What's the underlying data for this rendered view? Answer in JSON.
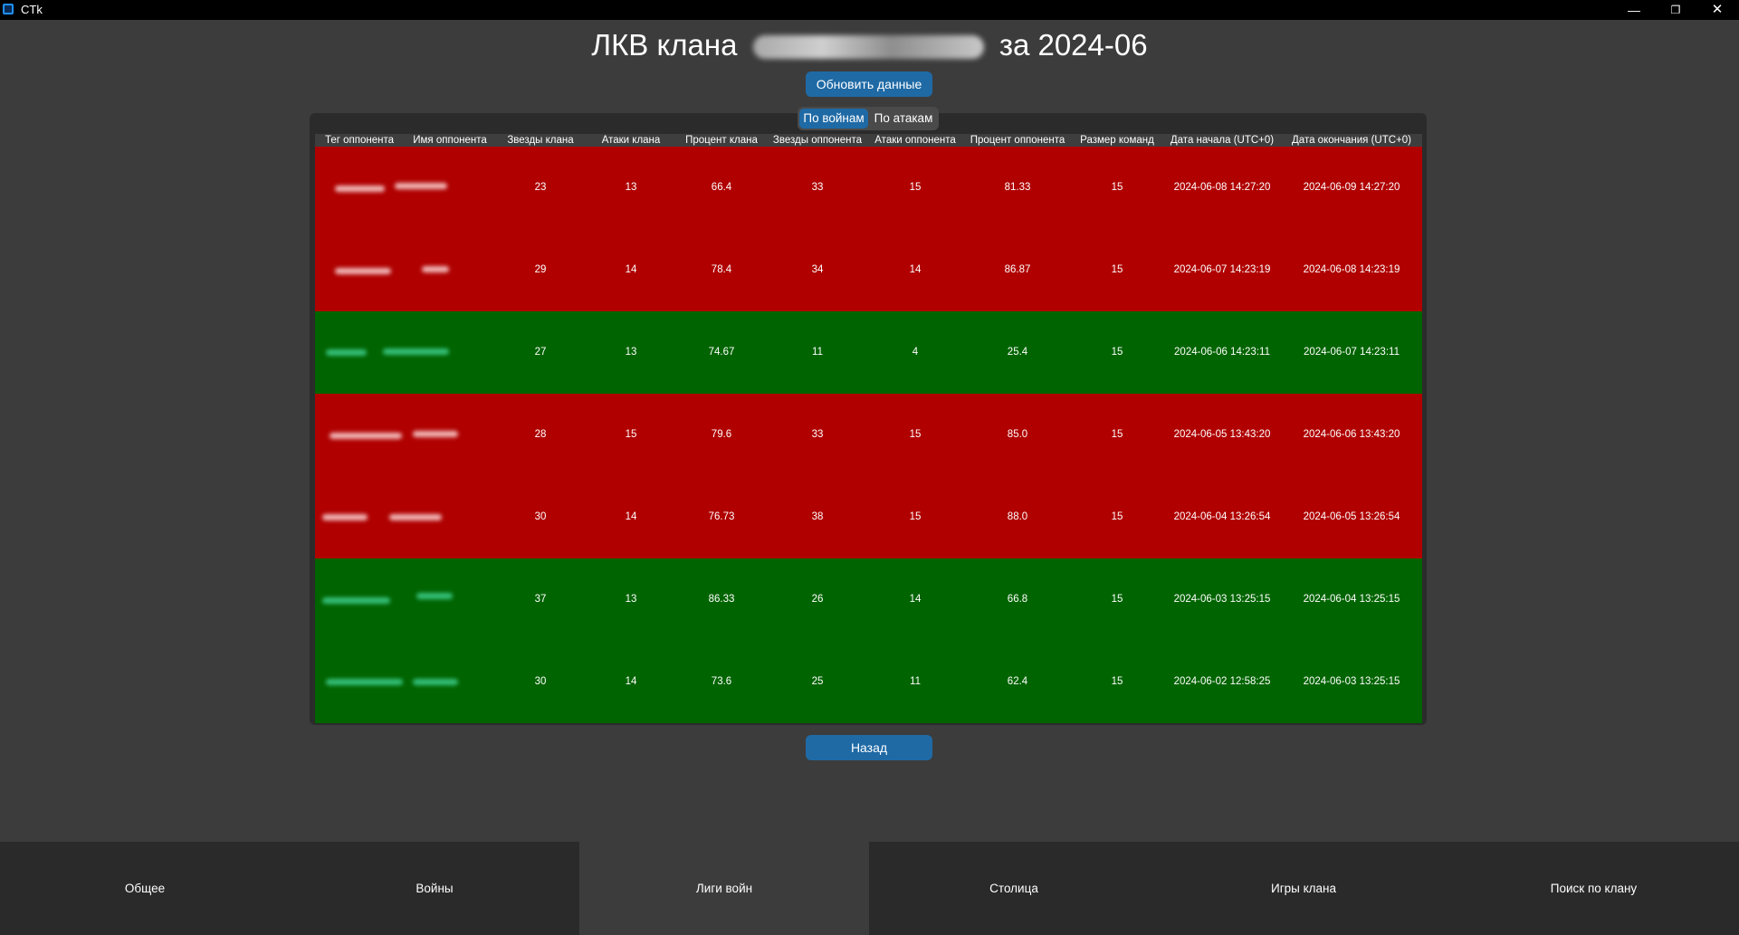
{
  "window": {
    "title": "CTk",
    "icon": "app-window-icon",
    "controls": {
      "minimize": "—",
      "maximize": "❐",
      "close": "✕"
    }
  },
  "header": {
    "title_prefix": "ЛКВ клана",
    "title_suffix": "за 2024-06",
    "refresh_label": "Обновить данные"
  },
  "segmented": {
    "options": [
      "По войнам",
      "По атакам"
    ],
    "selected": "По войнам"
  },
  "table": {
    "columns": [
      "Тег оппонента",
      "Имя оппонента",
      "Звезды клана",
      "Атаки клана",
      "Процент клана",
      "Звезды оппонента",
      "Атаки оппонента",
      "Процент оппонента",
      "Размер команд",
      "Дата начала (UTC+0)",
      "Дата окончания (UTC+0)"
    ],
    "rows": [
      {
        "result": "lose",
        "clan_stars": "23",
        "clan_attacks": "13",
        "clan_percent": "66.4",
        "opp_stars": "33",
        "opp_attacks": "15",
        "opp_percent": "81.33",
        "team_size": "15",
        "start": "2024-06-08 14:27:20",
        "end": "2024-06-09 14:27:20"
      },
      {
        "result": "lose",
        "clan_stars": "29",
        "clan_attacks": "14",
        "clan_percent": "78.4",
        "opp_stars": "34",
        "opp_attacks": "14",
        "opp_percent": "86.87",
        "team_size": "15",
        "start": "2024-06-07 14:23:19",
        "end": "2024-06-08 14:23:19"
      },
      {
        "result": "win",
        "clan_stars": "27",
        "clan_attacks": "13",
        "clan_percent": "74.67",
        "opp_stars": "11",
        "opp_attacks": "4",
        "opp_percent": "25.4",
        "team_size": "15",
        "start": "2024-06-06 14:23:11",
        "end": "2024-06-07 14:23:11"
      },
      {
        "result": "lose",
        "clan_stars": "28",
        "clan_attacks": "15",
        "clan_percent": "79.6",
        "opp_stars": "33",
        "opp_attacks": "15",
        "opp_percent": "85.0",
        "team_size": "15",
        "start": "2024-06-05 13:43:20",
        "end": "2024-06-06 13:43:20"
      },
      {
        "result": "lose",
        "clan_stars": "30",
        "clan_attacks": "14",
        "clan_percent": "76.73",
        "opp_stars": "38",
        "opp_attacks": "15",
        "opp_percent": "88.0",
        "team_size": "15",
        "start": "2024-06-04 13:26:54",
        "end": "2024-06-05 13:26:54"
      },
      {
        "result": "win",
        "clan_stars": "37",
        "clan_attacks": "13",
        "clan_percent": "86.33",
        "opp_stars": "26",
        "opp_attacks": "14",
        "opp_percent": "66.8",
        "team_size": "15",
        "start": "2024-06-03 13:25:15",
        "end": "2024-06-04 13:25:15"
      },
      {
        "result": "win",
        "clan_stars": "30",
        "clan_attacks": "14",
        "clan_percent": "73.6",
        "opp_stars": "25",
        "opp_attacks": "11",
        "opp_percent": "62.4",
        "team_size": "15",
        "start": "2024-06-02 12:58:25",
        "end": "2024-06-03 13:25:15"
      }
    ]
  },
  "back_label": "Назад",
  "tabs": {
    "items": [
      "Общее",
      "Войны",
      "Лиги войн",
      "Столица",
      "Игры клана",
      "Поиск по клану"
    ],
    "active": "Лиги войн"
  },
  "colors": {
    "lose_row": "#b00000",
    "win_row": "#006400",
    "accent": "#1f6aa5",
    "background": "#3c3c3c"
  }
}
